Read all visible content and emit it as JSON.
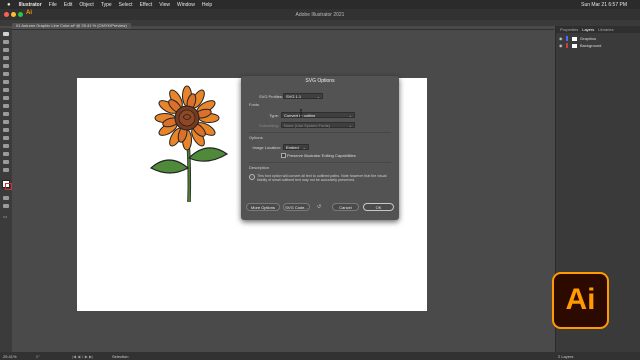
{
  "menubar": {
    "apple": "",
    "items": [
      "Illustrator",
      "File",
      "Edit",
      "Object",
      "Type",
      "Select",
      "Effect",
      "View",
      "Window",
      "Help"
    ],
    "clock": "Sun Mar 21  6:57 PM"
  },
  "app": {
    "title": "Adobe Illustrator 2021"
  },
  "document": {
    "tab_label": "01 Autumn Graphic Line Color.ai* @ 25.41 % (CMYK/Preview)"
  },
  "panel": {
    "tabs": [
      "Properties",
      "Layers",
      "Libraries"
    ],
    "active_tab": "Layers",
    "layers": [
      {
        "name": "Graphics",
        "color": "#4b6bff"
      },
      {
        "name": "Background",
        "color": "#d23b3b"
      }
    ]
  },
  "dialog": {
    "title": "SVG Options",
    "svg_profiles_label": "SVG Profiles:",
    "svg_profiles_value": "SVG 1.1",
    "fonts_section": "Fonts",
    "type_label": "Type:",
    "type_value": "Convert to outline",
    "subsetting_label": "Subsetting:",
    "subsetting_value": "None (Use System Fonts)",
    "options_section": "Options",
    "image_location_label": "Image Location:",
    "image_location_value": "Embed",
    "preserve_label": "Preserve Illustrator Editing Capabilities",
    "description_section": "Description",
    "description_text": "This font option will convert all text to outlined paths. Note however that the visual fidelity of small outlined text may not be accurately preserved.",
    "more_options": "More Options",
    "svg_code": "SVG Code...",
    "cancel": "Cancel",
    "ok": "OK"
  },
  "statusbar": {
    "zoom": "25.41%",
    "tool": "Selection",
    "layers_count": "2 Layers"
  },
  "logo": {
    "text": "Ai"
  },
  "colors": {
    "accent": "#ff9a00",
    "logo_bg": "#2d0a00",
    "artboard": "#ffffff"
  }
}
